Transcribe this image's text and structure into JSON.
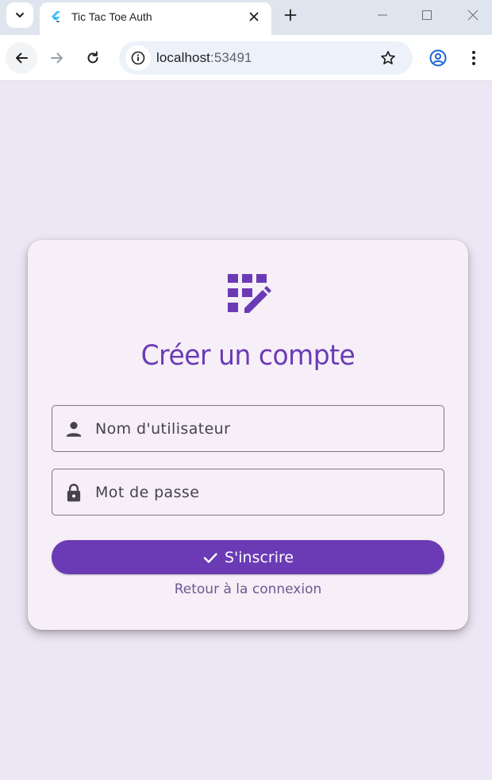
{
  "browser": {
    "tab_title": "Tic Tac Toe Auth",
    "url_host": "localhost",
    "url_port": ":53491"
  },
  "icons": {
    "tab_menu": "chevron-down-icon",
    "favicon": "flutter-icon",
    "tab_close": "close-icon",
    "new_tab": "plus-icon",
    "back": "arrow-left-icon",
    "forward": "arrow-right-icon",
    "reload": "reload-icon",
    "site_info": "info-icon",
    "bookmark": "star-icon",
    "profile": "account-icon",
    "menu": "more-vert-icon",
    "app": "grid-edit-icon",
    "username": "person-icon",
    "password": "lock-icon",
    "submit": "check-icon"
  },
  "colors": {
    "accent": "#6a3bb5",
    "page_background": "#ede6f4",
    "card_background": "#f6eff8",
    "link": "#6c5990"
  },
  "card": {
    "title": "Créer un compte",
    "username_placeholder": "Nom d'utilisateur",
    "password_placeholder": "Mot de passe",
    "submit_label": "S'inscrire",
    "back_link": "Retour à la connexion"
  }
}
